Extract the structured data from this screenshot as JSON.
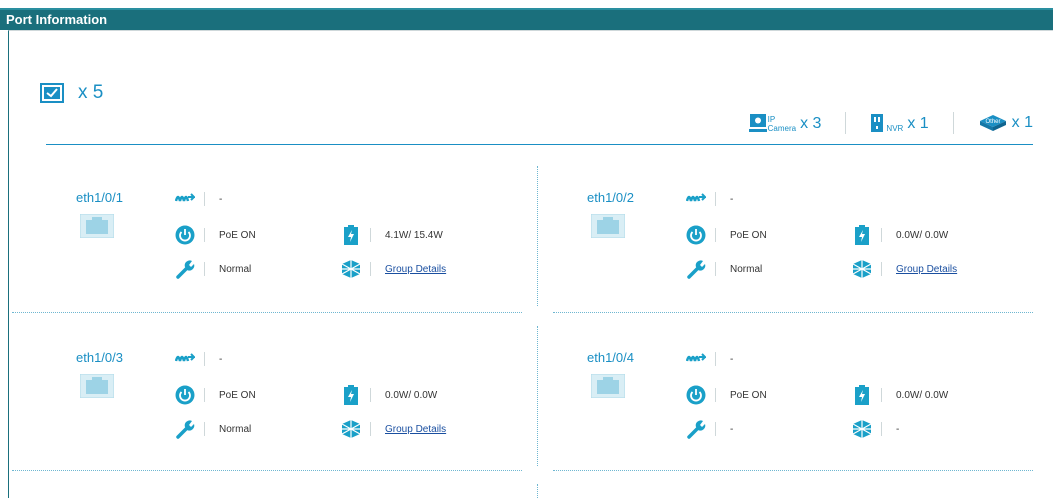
{
  "title": "Port Information",
  "summary": {
    "check_count": "x 5",
    "devices": [
      {
        "icon": "ip-camera-icon",
        "label_top": "IP",
        "label_bottom": "Camera",
        "count": "x 3"
      },
      {
        "icon": "nvr-icon",
        "label_bottom": "NVR",
        "count": "x 1"
      },
      {
        "icon": "other-icon",
        "label_top": "Other",
        "count": "x 1"
      }
    ]
  },
  "ports": [
    {
      "name": "eth1/0/1",
      "link": "-",
      "poe": "PoE ON",
      "power": "4.1W/ 15.4W",
      "status": "Normal",
      "group": "Group Details"
    },
    {
      "name": "eth1/0/2",
      "link": "-",
      "poe": "PoE ON",
      "power": "0.0W/ 0.0W",
      "status": "Normal",
      "group": "Group Details"
    },
    {
      "name": "eth1/0/3",
      "link": "-",
      "poe": "PoE ON",
      "power": "0.0W/ 0.0W",
      "status": "Normal",
      "group": "Group Details"
    },
    {
      "name": "eth1/0/4",
      "link": "-",
      "poe": "PoE ON",
      "power": "0.0W/ 0.0W",
      "status": "-",
      "group": "-"
    }
  ],
  "colors": {
    "accent": "#1a8fc4",
    "header": "#1a6f7c",
    "icon": "#1aa0c8"
  }
}
